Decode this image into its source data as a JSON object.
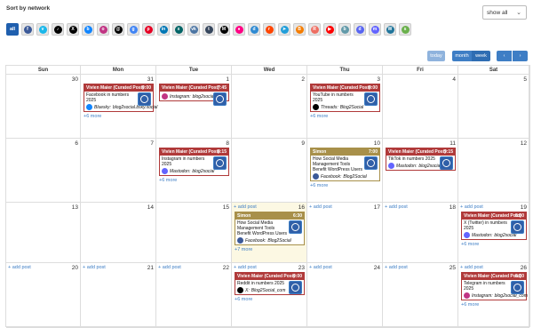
{
  "sort_label": "Sort by network",
  "show_select": {
    "value": "show all"
  },
  "network_all": "all",
  "network_icons": [
    {
      "name": "facebook",
      "color": "#3b5998",
      "glyph": "f"
    },
    {
      "name": "vimeo",
      "color": "#1ab7ea",
      "glyph": "v"
    },
    {
      "name": "tiktok",
      "color": "#000000",
      "glyph": "♪"
    },
    {
      "name": "x-twitter",
      "color": "#000000",
      "glyph": "X"
    },
    {
      "name": "bluesky",
      "color": "#1185fe",
      "glyph": "b"
    },
    {
      "name": "instagram",
      "color": "#c13584",
      "glyph": "o"
    },
    {
      "name": "threads",
      "color": "#000000",
      "glyph": "@"
    },
    {
      "name": "google-business",
      "color": "#4285f4",
      "glyph": "g"
    },
    {
      "name": "pinterest",
      "color": "#e60023",
      "glyph": "p"
    },
    {
      "name": "linkedin",
      "color": "#0077b5",
      "glyph": "in"
    },
    {
      "name": "xing",
      "color": "#026466",
      "glyph": "x"
    },
    {
      "name": "vk",
      "color": "#4c75a3",
      "glyph": "vk"
    },
    {
      "name": "tumblr",
      "color": "#36465d",
      "glyph": "t"
    },
    {
      "name": "medium",
      "color": "#000000",
      "glyph": "M"
    },
    {
      "name": "flickr",
      "color": "#ff0084",
      "glyph": "●"
    },
    {
      "name": "diigo",
      "color": "#2f8ad2",
      "glyph": "d"
    },
    {
      "name": "reddit",
      "color": "#ff4500",
      "glyph": "r"
    },
    {
      "name": "telegram",
      "color": "#229ed9",
      "glyph": "➤"
    },
    {
      "name": "blogger",
      "color": "#f57d00",
      "glyph": "B"
    },
    {
      "name": "ravelry",
      "color": "#ee6e62",
      "glyph": "R"
    },
    {
      "name": "youtube",
      "color": "#ff0000",
      "glyph": "▶"
    },
    {
      "name": "bandcamp",
      "color": "#629aa9",
      "glyph": "b"
    },
    {
      "name": "discord",
      "color": "#5865f2",
      "glyph": "d"
    },
    {
      "name": "mastodon",
      "color": "#6364ff",
      "glyph": "m"
    },
    {
      "name": "wordpress",
      "color": "#21759b",
      "glyph": "W"
    },
    {
      "name": "snapchat",
      "color": "#6ab04c",
      "glyph": "s"
    }
  ],
  "buttons": {
    "today": "today",
    "month": "month",
    "week": "week",
    "prev": "‹",
    "next": "›"
  },
  "weekdays": [
    "Sun",
    "Mon",
    "Tue",
    "Wed",
    "Thu",
    "Fri",
    "Sat"
  ],
  "weeks": [
    [
      {
        "d": "30"
      },
      {
        "d": "31",
        "posts": [
          {
            "author": "Vivien Maier (Curated Post)",
            "time": "0:00",
            "text": "Facebook in numbers 2025",
            "net": "Bluesky:",
            "acct": "blog2social.bsky.social",
            "icon": "bluesky"
          }
        ],
        "more": "+6 more"
      },
      {
        "d": "1",
        "posts": [
          {
            "author": "Vivien Maier (Curated Post)",
            "time": "7:45",
            "text": "",
            "net": "Instagram:",
            "acct": "blog2social_com",
            "icon": "instagram"
          }
        ]
      },
      {
        "d": "2"
      },
      {
        "d": "3",
        "posts": [
          {
            "author": "Vivien Maier (Curated Post)",
            "time": "0:00",
            "text": "YouTube in numbers 2025",
            "net": "Threads:",
            "acct": "Blog2Social",
            "icon": "threads"
          }
        ],
        "more": "+6 more"
      },
      {
        "d": "4"
      },
      {
        "d": "5"
      }
    ],
    [
      {
        "d": "6"
      },
      {
        "d": "7"
      },
      {
        "d": "8",
        "posts": [
          {
            "author": "Vivien Maier (Curated Post)",
            "time": "8:15",
            "text": "Instagram in numbers 2025",
            "net": "Mastodon:",
            "acct": "blog2social",
            "icon": "mastodon"
          }
        ],
        "more": "+6 more"
      },
      {
        "d": "9"
      },
      {
        "d": "10",
        "posts": [
          {
            "author": "Simon",
            "time": "7:00",
            "text": "How Social Media Management Tools Benefit WordPress Users",
            "net": "Facebook:",
            "acct": "Blog2Social",
            "icon": "facebook",
            "gold": true
          }
        ],
        "more": "+6 more"
      },
      {
        "d": "11",
        "posts": [
          {
            "author": "Vivien Maier (Curated Post)",
            "time": "9:15",
            "text": "TikTok in numbers 2025",
            "net": "Mastodon:",
            "acct": "blog2social",
            "icon": "mastodon"
          }
        ]
      },
      {
        "d": "12"
      }
    ],
    [
      {
        "d": "13"
      },
      {
        "d": "14"
      },
      {
        "d": "15"
      },
      {
        "d": "16",
        "today": true,
        "add": "+ add post",
        "posts": [
          {
            "author": "Simon",
            "time": "6:30",
            "text": "How Social Media Management Tools Benefit WordPress Users",
            "net": "Facebook:",
            "acct": "Blog2Social",
            "icon": "facebook",
            "gold": true
          }
        ],
        "more": "+7 more"
      },
      {
        "d": "17",
        "add": "+ add post"
      },
      {
        "d": "18",
        "add": "+ add post"
      },
      {
        "d": "19",
        "add": "+ add post",
        "posts": [
          {
            "author": "Vivien Maier (Curated Post)",
            "time": "8:00",
            "text": "X (Twitter) in numbers 2025",
            "net": "Mastodon:",
            "acct": "blog2social",
            "icon": "mastodon"
          }
        ],
        "more": "+6 more"
      }
    ],
    [
      {
        "d": "20",
        "add": "+ add post"
      },
      {
        "d": "21",
        "add": "+ add post"
      },
      {
        "d": "22",
        "add": "+ add post"
      },
      {
        "d": "23",
        "add": "+ add post",
        "posts": [
          {
            "author": "Vivien Maier (Curated Post)",
            "time": "0:00",
            "text": "Reddit in numbers 2025",
            "net": "X:",
            "acct": "Blog2Social_com",
            "icon": "x"
          }
        ],
        "more": "+6 more"
      },
      {
        "d": "24",
        "add": "+ add post"
      },
      {
        "d": "25",
        "add": "+ add post"
      },
      {
        "d": "26",
        "add": "+ add post",
        "posts": [
          {
            "author": "Vivien Maier (Curated Post)",
            "time": "8:30",
            "text": "Telegram in numbers 2025",
            "net": "Instagram:",
            "acct": "blog2social_com",
            "icon": "instagram"
          }
        ],
        "more": "+6 more"
      }
    ]
  ],
  "icon_colors": {
    "bluesky": "#1185fe",
    "instagram": "#c13584",
    "threads": "#000000",
    "mastodon": "#6364ff",
    "facebook": "#3b5998",
    "x": "#000000"
  }
}
